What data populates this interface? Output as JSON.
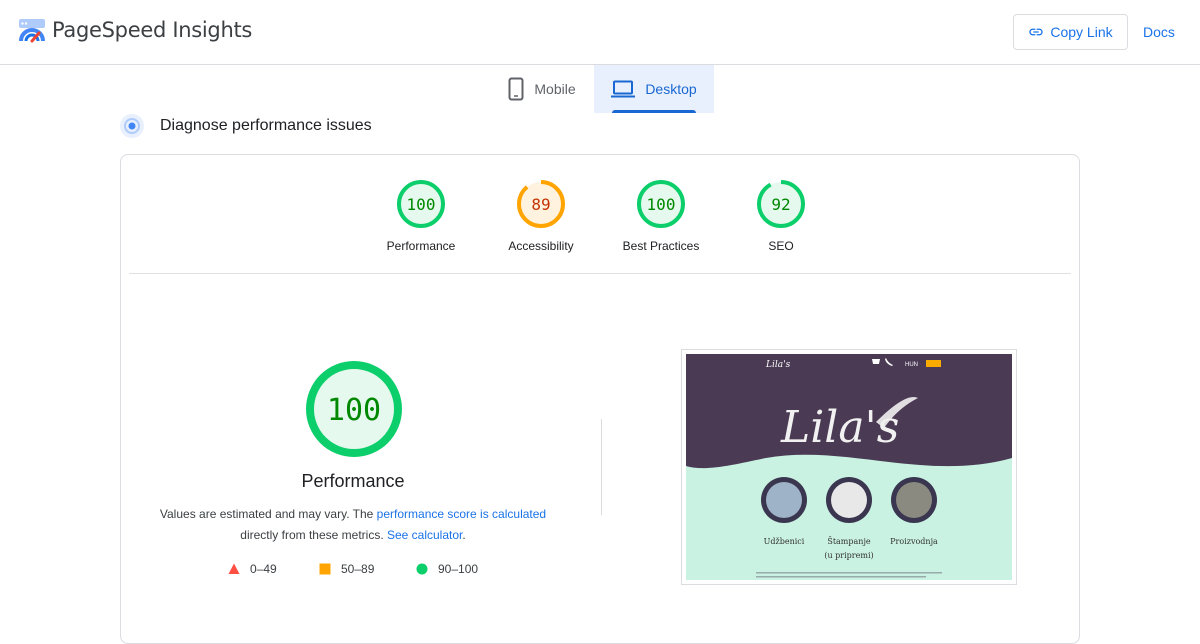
{
  "header": {
    "app_title": "PageSpeed Insights",
    "copy_link_label": "Copy Link",
    "docs_label": "Docs"
  },
  "tabs": [
    {
      "label": "Mobile",
      "icon": "smartphone-icon",
      "selected": false
    },
    {
      "label": "Desktop",
      "icon": "laptop-icon",
      "selected": true
    }
  ],
  "diagnose": {
    "title": "Diagnose performance issues"
  },
  "scores": [
    {
      "label": "Performance",
      "value": "100",
      "color": "#0cce6b"
    },
    {
      "label": "Accessibility",
      "value": "89",
      "color": "#ffa400"
    },
    {
      "label": "Best Practices",
      "value": "100",
      "color": "#0cce6b"
    },
    {
      "label": "SEO",
      "value": "92",
      "color": "#0cce6b"
    }
  ],
  "main_gauge": {
    "value": "100",
    "label": "Performance",
    "desc_prefix": "Values are estimated and may vary. The ",
    "desc_link1": "performance score is calculated",
    "desc_middle": " directly from these metrics. ",
    "desc_link2": "See calculator",
    "desc_suffix": "."
  },
  "legend": [
    {
      "range": "0–49",
      "shape": "triangle",
      "color": "#ff4e42"
    },
    {
      "range": "50–89",
      "shape": "square",
      "color": "#ffa400"
    },
    {
      "range": "90–100",
      "shape": "circle",
      "color": "#0cce6b"
    }
  ],
  "screenshot": {
    "brand": "Lila's",
    "lang": "HUN",
    "items": [
      "Udžbenici",
      "Štampanje",
      "Proizvodnja"
    ],
    "sub": "(u pripremi)"
  }
}
